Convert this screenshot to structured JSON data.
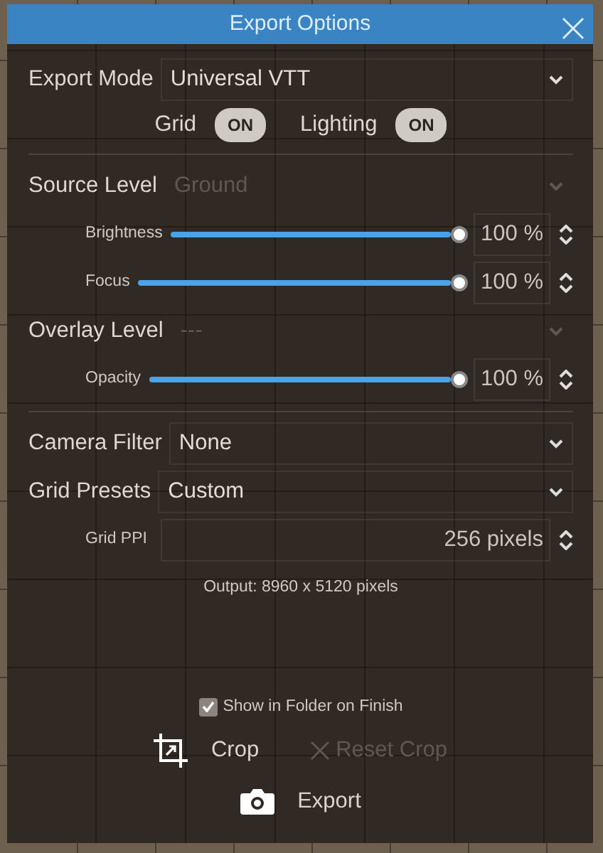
{
  "window": {
    "title": "Export Options"
  },
  "export_mode": {
    "label": "Export Mode",
    "value": "Universal VTT",
    "disabled": false
  },
  "toggles": [
    {
      "label": "Grid",
      "text": "ON",
      "on": true
    },
    {
      "label": "Lighting",
      "text": "ON",
      "on": true
    }
  ],
  "source_level": {
    "label": "Source Level",
    "value": "Ground",
    "disabled": true
  },
  "source_sliders": [
    {
      "label": "Brightness",
      "level": 1,
      "reading": "100 %"
    },
    {
      "label": "Focus",
      "level": 1,
      "reading": "100 %"
    }
  ],
  "overlay_level": {
    "label": "Overlay Level",
    "value": "---",
    "disabled": true
  },
  "overlay_sliders": [
    {
      "label": "Opacity",
      "level": 1,
      "reading": "100 %"
    }
  ],
  "camera_filter": {
    "label": "Camera Filter",
    "value": "None",
    "disabled": false
  },
  "grid_presets": {
    "label": "Grid Presets",
    "value": "Custom",
    "disabled": false
  },
  "grid_ppi": {
    "label": "Grid PPI",
    "value": "256 pixels"
  },
  "output": "Output: 8960 x 5120 pixels",
  "show_in_folder": {
    "label": "Show in Folder on Finish",
    "checked": true
  },
  "crop_button": {
    "label": "Crop",
    "disabled": false
  },
  "reset_crop_button": {
    "label": "Reset Crop",
    "disabled": true
  },
  "export_button": {
    "label": "Export",
    "disabled": false
  }
}
